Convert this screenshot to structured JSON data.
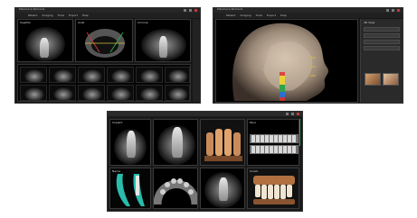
{
  "window_a": {
    "title": "Planmeca Romexis",
    "menu": [
      "Patient",
      "Imaging",
      "Tools",
      "Export",
      "Help"
    ],
    "tabs": [
      "Axial",
      "Sagittal",
      "Coronal"
    ]
  },
  "window_b": {
    "title": "Planmeca Romexis",
    "menu": [
      "Patient",
      "Imaging",
      "Tools",
      "Export",
      "Help"
    ],
    "panel_title": "3D View"
  },
  "window_c": {
    "tabs": [
      "Implant",
      "Nerve",
      "Crown",
      "Pano"
    ]
  },
  "colors": {
    "window_bg": "#161616",
    "viewport_bg": "#000000",
    "accent_red": "#c23a3a",
    "accent_green": "#2ea34a",
    "nerve_teal": "#2fd0c0"
  }
}
